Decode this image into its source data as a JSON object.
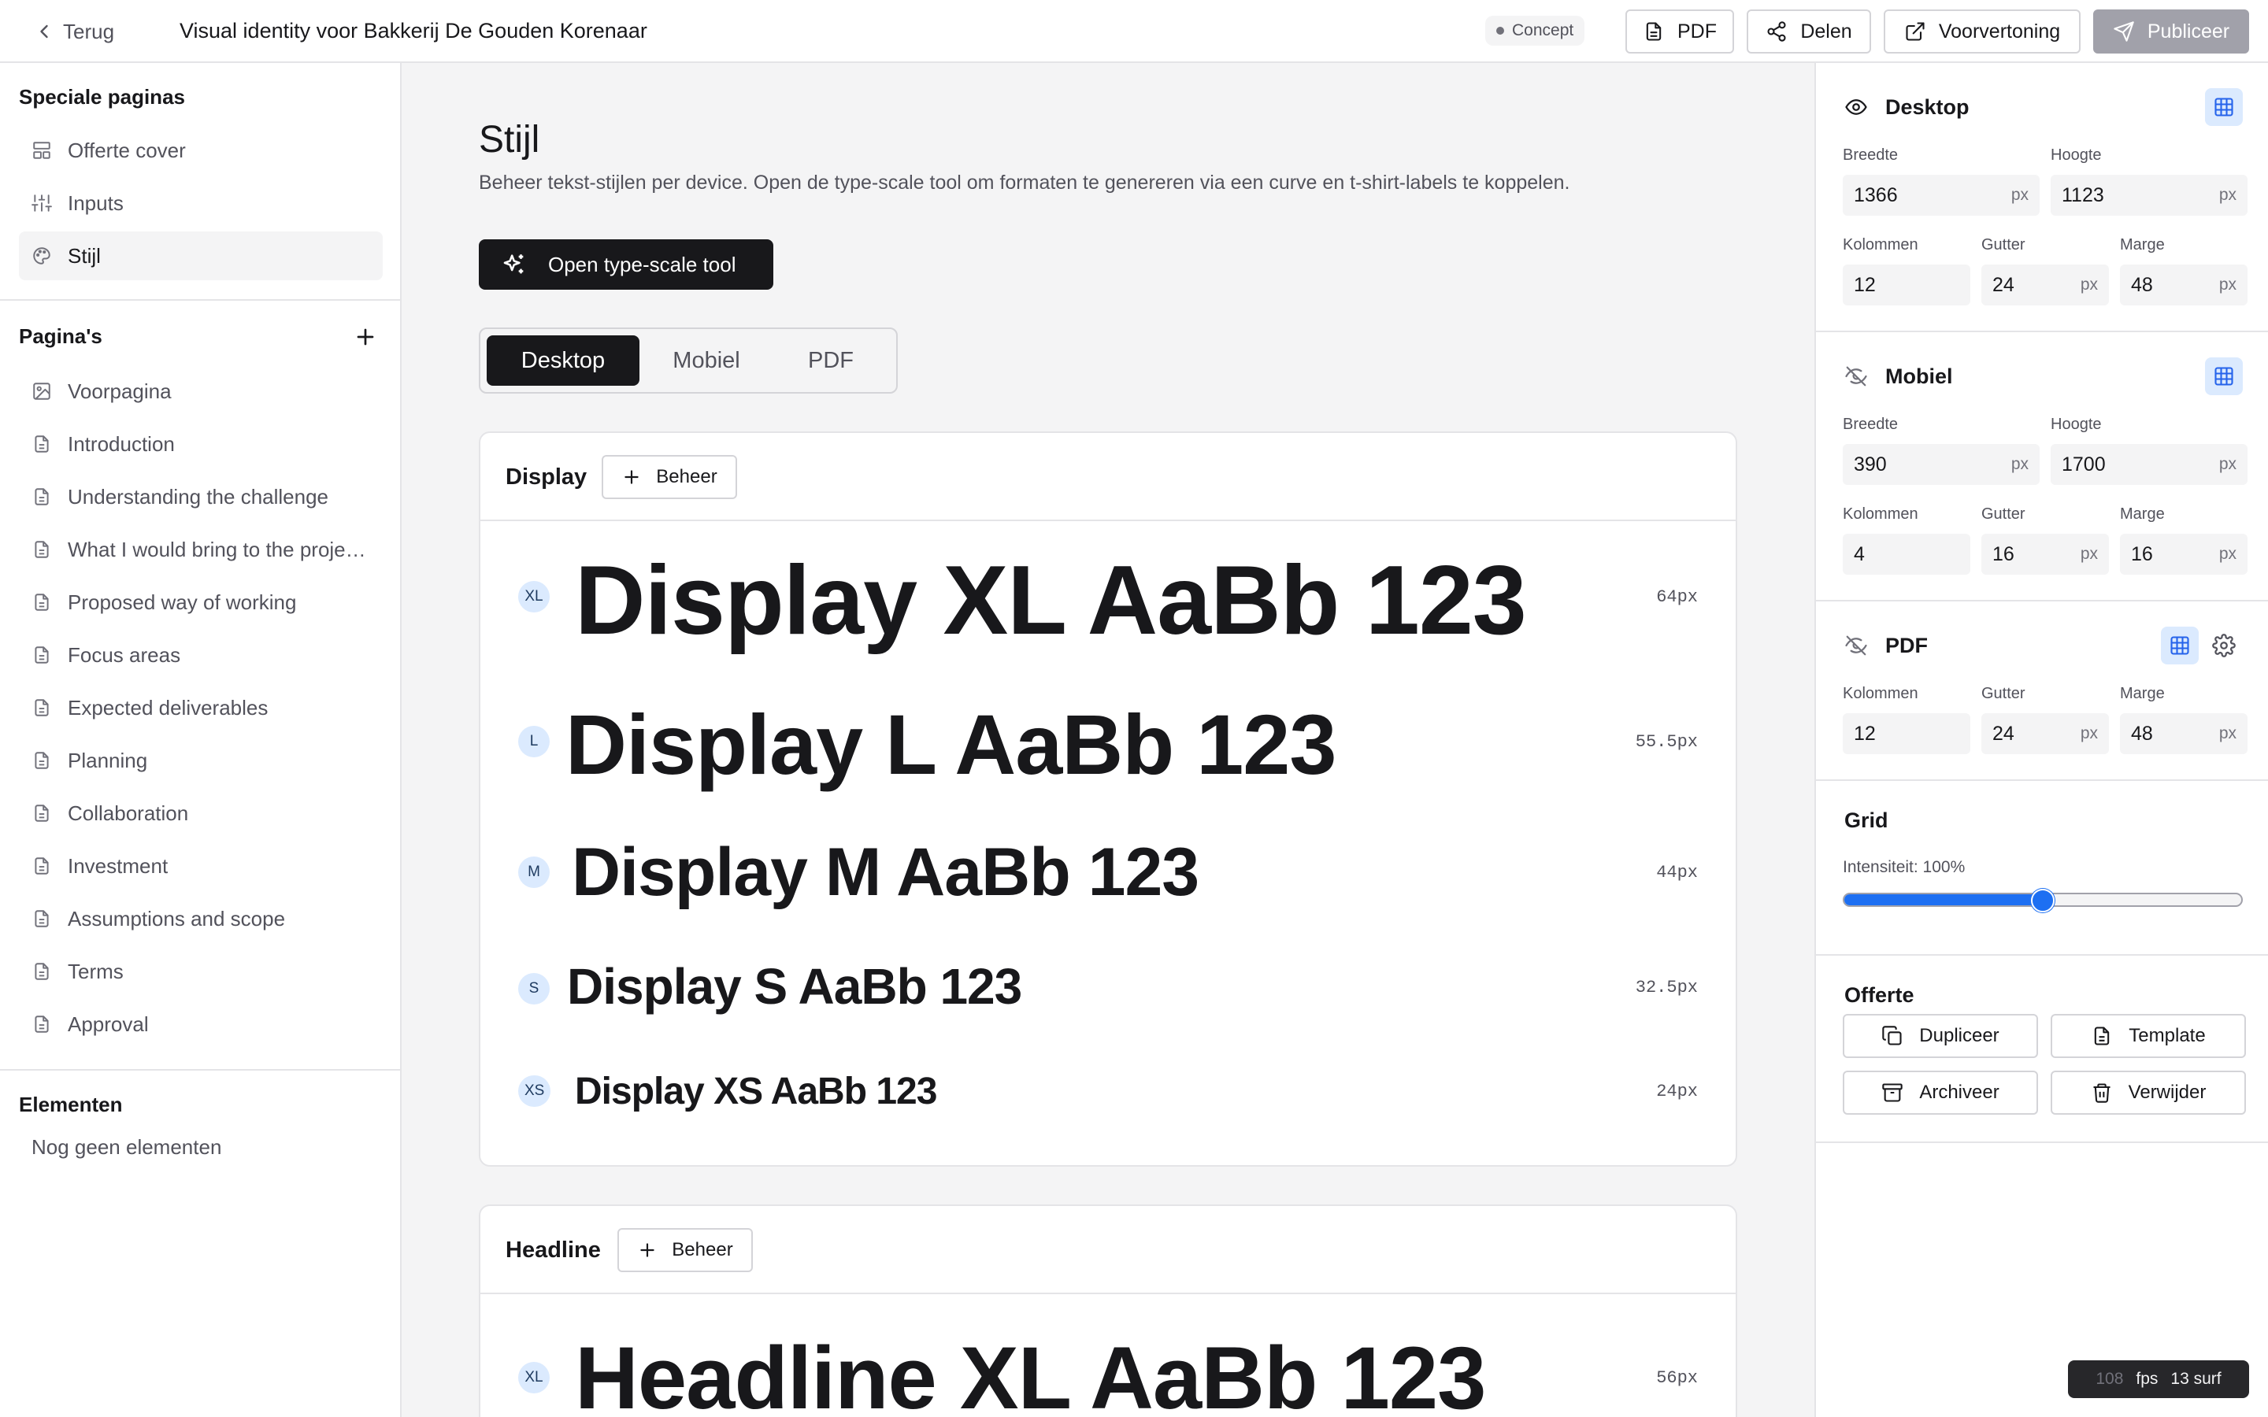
{
  "topbar": {
    "back_label": "Terug",
    "title": "Visual identity voor Bakkerij De Gouden Korenaar",
    "status": "Concept",
    "pdf_label": "PDF",
    "share_label": "Delen",
    "preview_label": "Voorvertoning",
    "publish_label": "Publiceer"
  },
  "sidebar": {
    "special_title": "Speciale paginas",
    "special_items": [
      {
        "label": "Offerte cover",
        "icon": "layout-icon"
      },
      {
        "label": "Inputs",
        "icon": "sliders-icon"
      },
      {
        "label": "Stijl",
        "icon": "palette-icon",
        "active": true
      }
    ],
    "pages_title": "Pagina's",
    "pages": [
      {
        "label": "Voorpagina",
        "icon": "image-icon"
      },
      {
        "label": "Introduction",
        "icon": "document-icon"
      },
      {
        "label": "Understanding the challenge",
        "icon": "document-icon"
      },
      {
        "label": "What I would bring to the proje…",
        "icon": "document-icon"
      },
      {
        "label": "Proposed way of working",
        "icon": "document-icon"
      },
      {
        "label": "Focus areas",
        "icon": "document-icon"
      },
      {
        "label": "Expected deliverables",
        "icon": "document-icon"
      },
      {
        "label": "Planning",
        "icon": "document-icon"
      },
      {
        "label": "Collaboration",
        "icon": "document-icon"
      },
      {
        "label": "Investment",
        "icon": "document-icon"
      },
      {
        "label": "Assumptions and scope",
        "icon": "document-icon"
      },
      {
        "label": "Terms",
        "icon": "document-icon"
      },
      {
        "label": "Approval",
        "icon": "document-icon"
      }
    ],
    "elements_title": "Elementen",
    "elements_empty": "Nog geen elementen"
  },
  "main": {
    "title": "Stijl",
    "description": "Beheer tekst-stijlen per device. Open de type-scale tool om formaten te genereren via een curve en t-shirt-labels te koppelen.",
    "type_scale_button": "Open type-scale tool",
    "tabs": [
      {
        "label": "Desktop",
        "active": true
      },
      {
        "label": "Mobiel"
      },
      {
        "label": "PDF"
      }
    ],
    "display": {
      "title": "Display",
      "manage_label": "Beheer",
      "rows": [
        {
          "tag": "XL",
          "sample": "Display XL AaBb 123",
          "size": "64px"
        },
        {
          "tag": "L",
          "sample": "Display L AaBb 123",
          "size": "55.5px"
        },
        {
          "tag": "M",
          "sample": "Display M AaBb 123",
          "size": "44px"
        },
        {
          "tag": "S",
          "sample": "Display S AaBb 123",
          "size": "32.5px"
        },
        {
          "tag": "XS",
          "sample": "Display XS AaBb 123",
          "size": "24px"
        }
      ]
    },
    "headline": {
      "title": "Headline",
      "manage_label": "Beheer",
      "rows": [
        {
          "tag": "XL",
          "sample": "Headline XL AaBb 123",
          "size": "56px"
        }
      ]
    }
  },
  "panel": {
    "desktop": {
      "title": "Desktop",
      "width_label": "Breedte",
      "width": "1366",
      "height_label": "Hoogte",
      "height": "1123",
      "columns_label": "Kolommen",
      "columns": "12",
      "gutter_label": "Gutter",
      "gutter": "24",
      "margin_label": "Marge",
      "margin": "48",
      "unit": "px"
    },
    "mobile": {
      "title": "Mobiel",
      "width_label": "Breedte",
      "width": "390",
      "height_label": "Hoogte",
      "height": "1700",
      "columns_label": "Kolommen",
      "columns": "4",
      "gutter_label": "Gutter",
      "gutter": "16",
      "margin_label": "Marge",
      "margin": "16",
      "unit": "px"
    },
    "pdf": {
      "title": "PDF",
      "columns_label": "Kolommen",
      "columns": "12",
      "gutter_label": "Gutter",
      "gutter": "24",
      "margin_label": "Marge",
      "margin": "48",
      "unit": "px"
    },
    "grid": {
      "title": "Grid",
      "intensity_label": "Intensiteit: 100%",
      "intensity_value": 0.5
    },
    "offer": {
      "title": "Offerte",
      "duplicate": "Dupliceer",
      "template": "Template",
      "archive": "Archiveer",
      "delete": "Verwijder"
    }
  },
  "fps": {
    "value": "108",
    "label": "fps",
    "surfaces": "13 surf"
  },
  "colors": {
    "accent": "#1d6ff2",
    "badge_bg": "#dbeafe",
    "primary_dark": "#18181b"
  }
}
